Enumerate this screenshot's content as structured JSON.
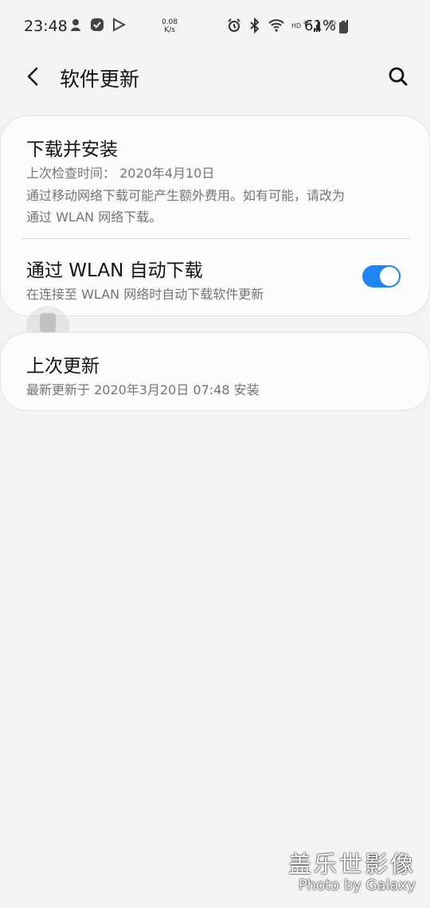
{
  "status_bar": {
    "time": "23:48",
    "speed_top": "0.08",
    "speed_bottom": "K/s",
    "battery_percent": "61%"
  },
  "topbar": {
    "title": "软件更新",
    "back_icon": "chevron-left-icon",
    "search_icon": "search-icon"
  },
  "card1": {
    "title": "下载并安装",
    "last_check": "上次检查时间： 2020年4月10日",
    "note_line1": "通过移动网络下载可能产生额外费用。如有可能，请改为",
    "note_line2": "通过 WLAN 网络下载。",
    "auto_title": "通过 WLAN 自动下载",
    "auto_sub": "在连接至 WLAN 网络时自动下载软件更新",
    "toggle_on": true,
    "accent": "#1f86f4"
  },
  "card2": {
    "title": "上次更新",
    "sub": "最新更新于 2020年3月20日 07:48 安装"
  },
  "watermark": {
    "title": "盖乐世影像",
    "sub": "Photo by Galaxy"
  }
}
